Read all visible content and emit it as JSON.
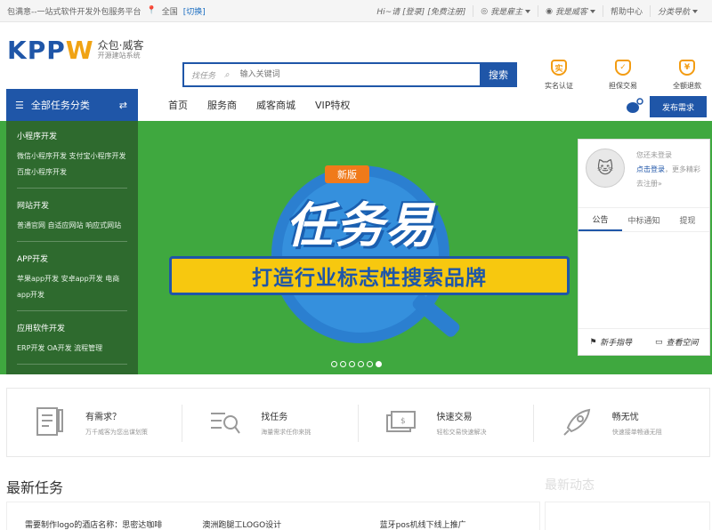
{
  "topbar": {
    "welcome": "包满意--一站式软件开发外包服务平台",
    "location": "全国",
    "switch": "[切换]",
    "greeting": "Hi~请",
    "login": "[登录]",
    "register": "[免费注册]",
    "employer": "我是雇主",
    "worker": "我是威客",
    "help": "帮助中心",
    "catnav": "分类导航"
  },
  "logo": {
    "brand": "KPPW",
    "name": "众包·威客",
    "sub": "开源建站系统"
  },
  "search": {
    "scope": "找任务",
    "placeholder": "输入关键词",
    "button": "搜索"
  },
  "badges": [
    {
      "icon": "实",
      "label": "实名认证"
    },
    {
      "icon": "✓",
      "label": "担保交易"
    },
    {
      "icon": "¥",
      "label": "全额退款"
    }
  ],
  "nav": {
    "category": "全部任务分类",
    "links": [
      "首页",
      "服务商",
      "威客商城",
      "VIP特权"
    ],
    "publish": "发布需求"
  },
  "sidebar": [
    {
      "title": "小程序开发",
      "items": "微信小程序开发 支付宝小程序开发 百度小程序开发"
    },
    {
      "title": "网站开发",
      "items": "普通官网 自适应网站 响应式网站"
    },
    {
      "title": "APP开发",
      "items": "苹果app开发 安卓app开发 电商app开发"
    },
    {
      "title": "应用软件开发",
      "items": "ERP开发 OA开发 流程管理"
    }
  ],
  "hero": {
    "tag": "新版",
    "headline": "任务易",
    "slogan": "打造行业标志性搜索品牌"
  },
  "panel": {
    "status": "您还未登录",
    "login_link": "点击登录",
    "login_rest": "，更多精彩",
    "register": "去注册»",
    "tabs": [
      "公告",
      "中标通知",
      "提现"
    ],
    "guide": "新手指导",
    "space": "查看空间"
  },
  "features": [
    {
      "title": "有需求？",
      "sub": "万千威客为您出谋划策"
    },
    {
      "title": "找任务",
      "sub": "海量需求任你来挑"
    },
    {
      "title": "快速交易",
      "sub": "轻松交易快速解决"
    },
    {
      "title": "畅无忧",
      "sub": "快速接单畅通无阻"
    }
  ],
  "section": {
    "title": "最新任务",
    "right_title": "最新动态"
  },
  "tasks": [
    "需要制作logo的酒店名称：思密达咖啡",
    "澳洲跑腿工LOGO设计",
    "蓝牙pos机线下线上推广"
  ],
  "colors": {
    "brand_blue": "#1f56a8",
    "banner_green": "#3fa83f",
    "badge_orange": "#f39c12"
  }
}
